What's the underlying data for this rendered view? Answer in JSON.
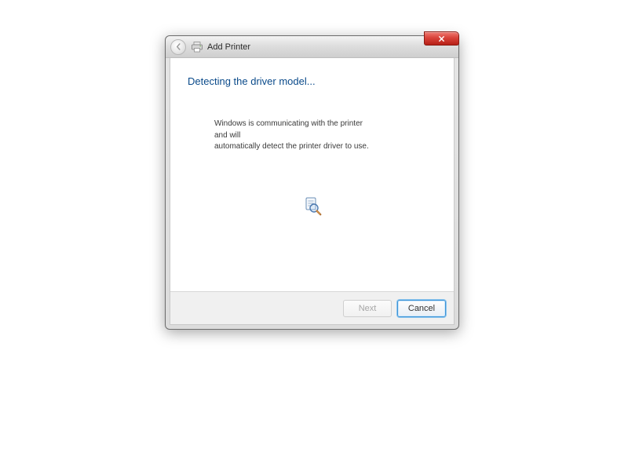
{
  "window": {
    "title": "Add Printer"
  },
  "content": {
    "heading": "Detecting the driver model...",
    "body_line1": "Windows is communicating with the printer and will",
    "body_line2": "automatically detect the printer driver to use."
  },
  "footer": {
    "next_label": "Next",
    "cancel_label": "Cancel"
  }
}
